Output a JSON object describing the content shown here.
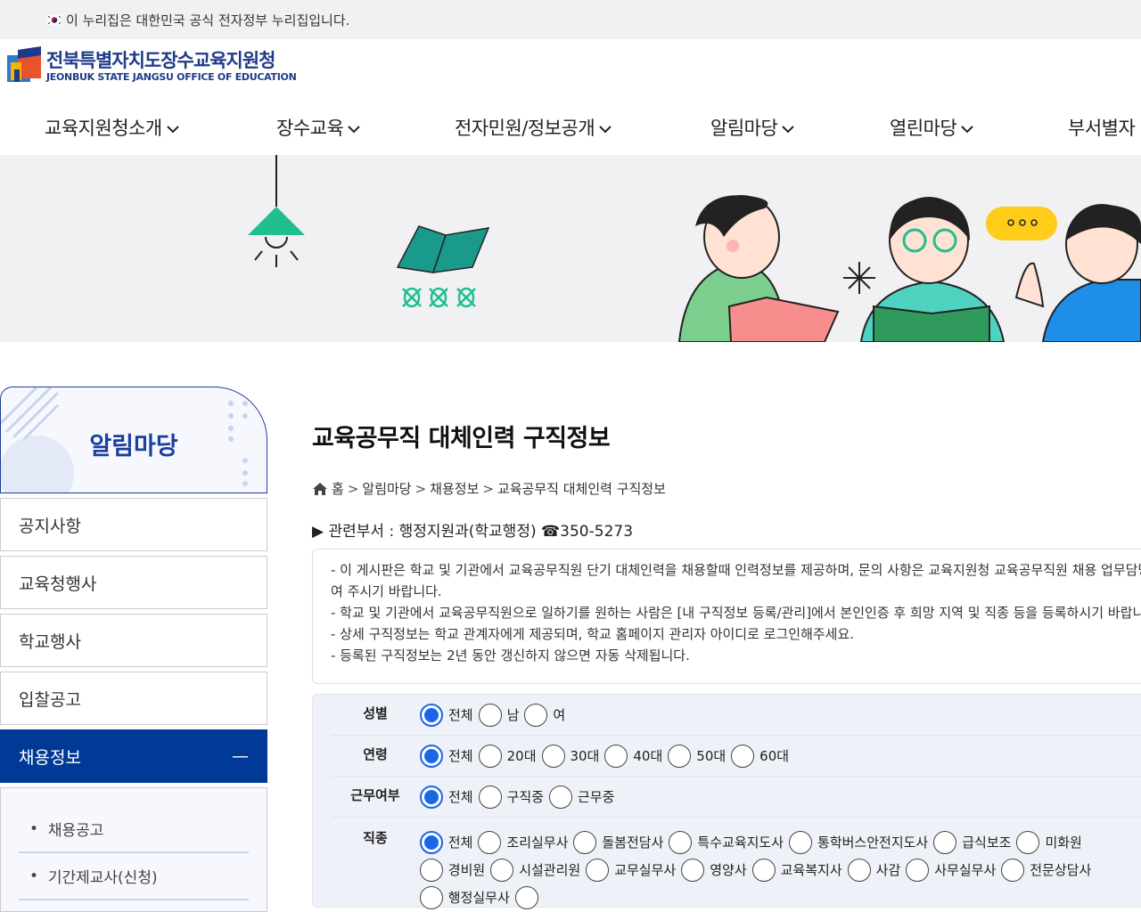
{
  "topbar": {
    "text": "이 누리집은 대한민국 공식 전자정부 누리집입니다."
  },
  "logo": {
    "name_ko": "전북특별자치도장수교육지원청",
    "name_en": "JEONBUK STATE JANGSU OFFICE OF EDUCATION"
  },
  "gnb": {
    "items": [
      "교육지원청소개",
      "장수교육",
      "전자민원/정보공개",
      "알림마당",
      "열린마당",
      "부서별자"
    ]
  },
  "snb": {
    "title": "알림마당",
    "items": [
      "공지사항",
      "교육청행사",
      "학교행사",
      "입찰공고",
      "채용정보"
    ],
    "active_symbol": "—",
    "sub_items": [
      "채용공고",
      "기간제교사(신청)"
    ]
  },
  "content": {
    "title": "교육공무직 대체인력 구직정보",
    "breadcrumb": [
      "홈",
      "알림마당",
      "채용정보",
      "교육공무직 대체인력 구직정보"
    ],
    "breadcrumb_sep": ">",
    "dept": "▶ 관련부서 : 행정지원과(학교행정) ☎350-5273",
    "notice": [
      "- 이 게시판은 학교 및 기관에서 교육공무직원 단기 대체인력을 채용할때 인력정보를 제공하며, 문의 사항은 교육지원청 교육공무직원 채용 업무담당",
      "여 주시기 바랍니다.",
      "- 학교 및 기관에서 교육공무직원으로 일하기를 원하는 사람은 [내 구직정보 등록/관리]에서 본인인증 후 희망 지역 및 직종 등을 등록하시기 바랍니다",
      "- 상세 구직정보는 학교 관계자에게 제공되며, 학교 홈페이지 관리자 아이디로 로그인해주세요.",
      "- 등록된 구직정보는 2년 동안 갱신하지 않으면 자동 삭제됩니다."
    ]
  },
  "filter": {
    "gender": {
      "label": "성별",
      "options": [
        "전체",
        "남",
        "여"
      ],
      "selected": 0
    },
    "age": {
      "label": "연령",
      "options": [
        "전체",
        "20대",
        "30대",
        "40대",
        "50대",
        "60대"
      ],
      "selected": 0
    },
    "work": {
      "label": "근무여부",
      "options": [
        "전체",
        "구직중",
        "근무중"
      ],
      "selected": 0
    },
    "job": {
      "label": "직종",
      "options": [
        "전체",
        "조리실무사",
        "돌봄전담사",
        "특수교육지도사",
        "통학버스안전지도사",
        "급식보조",
        "미화원",
        "경비원",
        "시설관리원",
        "교무실무사",
        "영양사",
        "교육복지사",
        "사감",
        "사무실무사",
        "전문상담사",
        "행정실무사",
        ""
      ],
      "selected": 0
    }
  },
  "colors": {
    "brand": "#1a3f9c",
    "active_menu": "#003a96",
    "radio": "#1a66e8"
  }
}
